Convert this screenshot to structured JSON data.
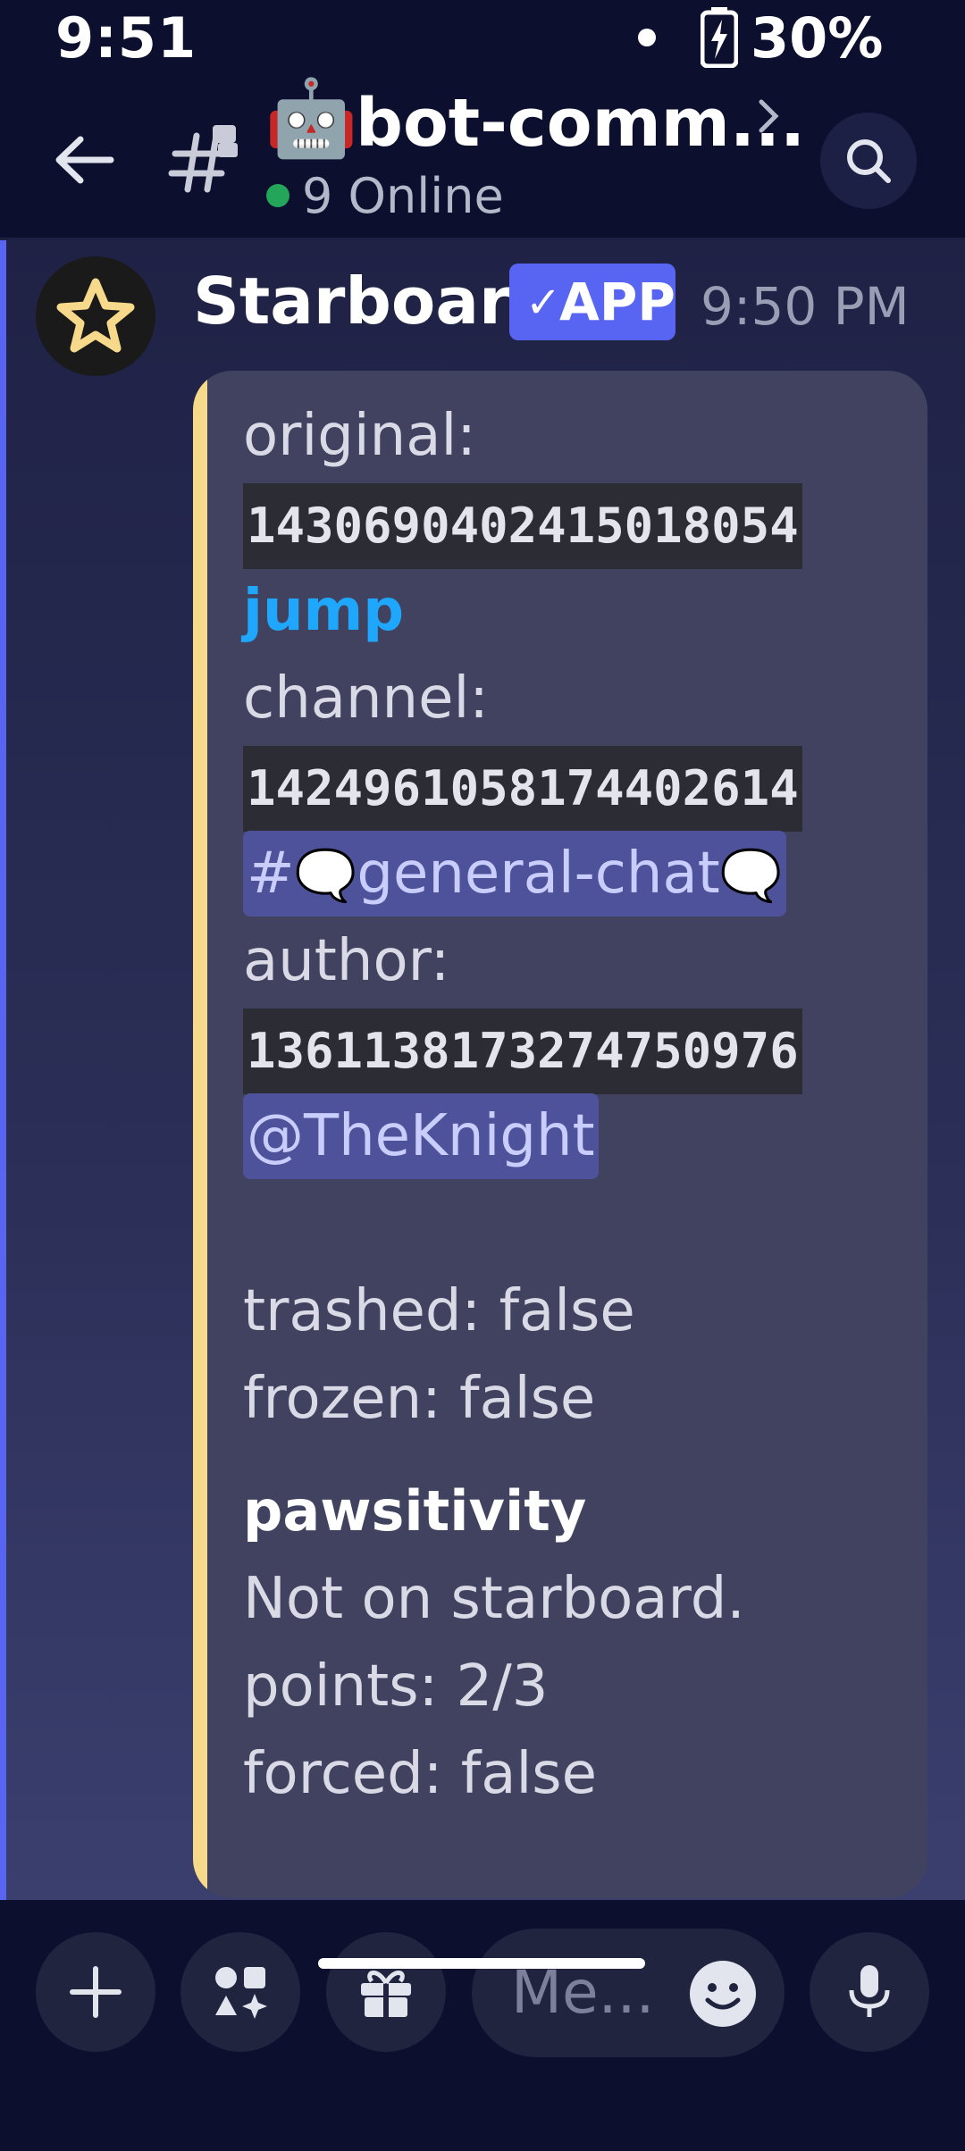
{
  "status_bar": {
    "time": "9:51",
    "battery": "30%"
  },
  "header": {
    "channel_emoji": "🤖",
    "channel_name": "bot-comm...",
    "online": "9 Online"
  },
  "message": {
    "author": "Starboard",
    "badge": "APP",
    "time": "9:50 PM",
    "embed": {
      "original_label": "original:",
      "original_id": "1430690402415018054",
      "jump_link": "jump",
      "channel_label": "channel:",
      "channel_id": "1424961058174402614",
      "channel_hash": "#",
      "channel_emoji": "🗨️",
      "channel_name": "general-chat",
      "author_label": "author:",
      "author_id": "1361138173274750976",
      "author_mention": "@TheKnight",
      "trashed": "trashed: false",
      "frozen": "frozen: false",
      "field_title": "pawsitivity",
      "status": "Not on starboard.",
      "points": "points: 2/3",
      "forced": "forced: false"
    }
  },
  "composer": {
    "placeholder": "Me..."
  },
  "colors": {
    "accent": "#5865f2",
    "embed_bar": "#f7d98b",
    "link": "#1ea7fd",
    "online": "#23a55a"
  },
  "icons": [
    "back-arrow-icon",
    "threads-icon",
    "search-icon",
    "star-icon",
    "plus-icon",
    "apps-icon",
    "gift-icon",
    "emoji-icon",
    "microphone-icon",
    "battery-charging-icon",
    "chevron-right-icon"
  ]
}
